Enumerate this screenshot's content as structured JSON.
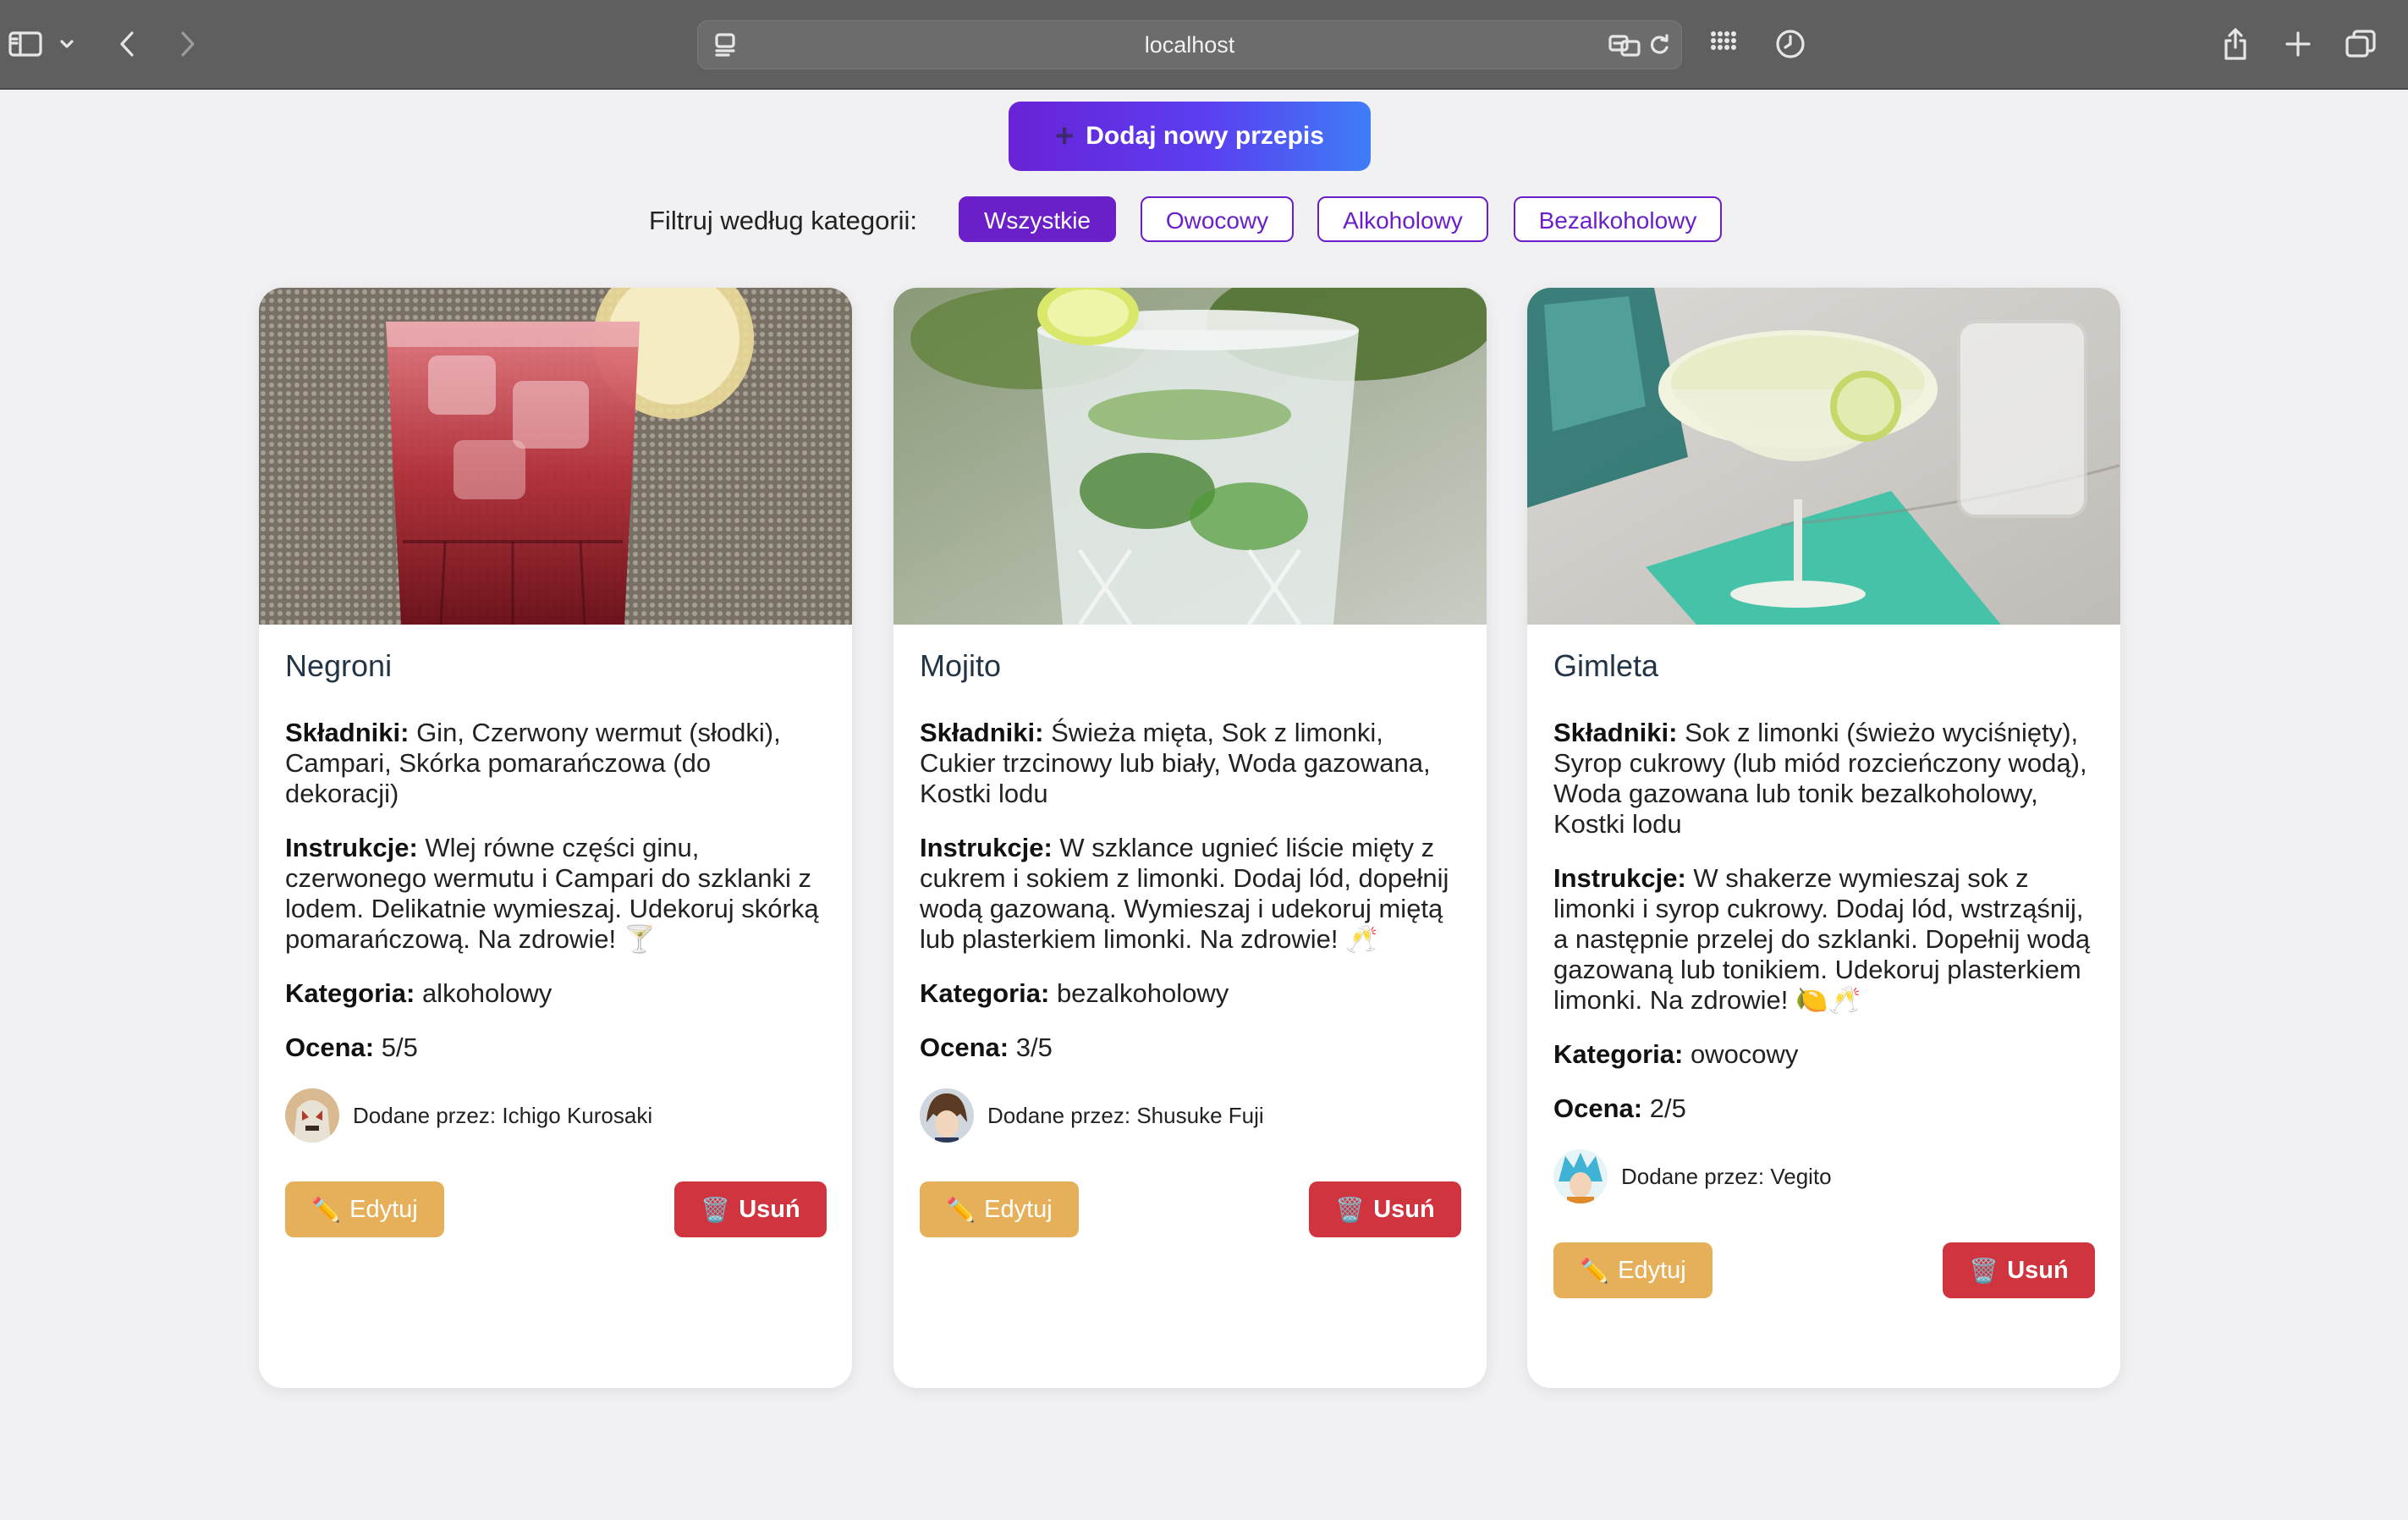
{
  "browser": {
    "url": "localhost"
  },
  "page": {
    "add_button_label": "Dodaj nowy przepis",
    "add_button_icon": "+",
    "filter_label": "Filtruj według kategorii:",
    "filters": [
      {
        "label": "Wszystkie",
        "active": true
      },
      {
        "label": "Owocowy",
        "active": false
      },
      {
        "label": "Alkoholowy",
        "active": false
      },
      {
        "label": "Bezalkoholowy",
        "active": false
      }
    ]
  },
  "labels": {
    "ingredients": "Składniki:",
    "instructions": "Instrukcje:",
    "category": "Kategoria:",
    "rating": "Ocena:",
    "added_by": "Dodane przez:",
    "edit": "Edytuj",
    "delete": "Usuń",
    "edit_icon": "✏️",
    "delete_icon": "🗑️"
  },
  "recipes": [
    {
      "name": "Negroni",
      "ingredients": "Gin, Czerwony wermut (słodki), Campari, Skórka pomarańczowa (do dekoracji)",
      "instructions": "Wlej równe części ginu, czerwonego wermutu i Campari do szklanki z lodem. Delikatnie wymieszaj. Udekoruj skórką pomarańczową. Na zdrowie! 🍸",
      "category": "alkoholowy",
      "rating": "5/5",
      "author": "Ichigo Kurosaki"
    },
    {
      "name": "Mojito",
      "ingredients": "Świeża mięta, Sok z limonki, Cukier trzcinowy lub biały, Woda gazowana, Kostki lodu",
      "instructions": "W szklance ugnieć liście mięty z cukrem i sokiem z limonki. Dodaj lód, dopełnij wodą gazowaną. Wymieszaj i udekoruj miętą lub plasterkiem limonki. Na zdrowie! 🥂",
      "category": "bezalkoholowy",
      "rating": "3/5",
      "author": "Shusuke Fuji"
    },
    {
      "name": "Gimleta",
      "ingredients": "Sok z limonki (świeżo wyciśnięty), Syrop cukrowy (lub miód rozcieńczony wodą), Woda gazowana lub tonik bezalkoholowy, Kostki lodu",
      "instructions": "W shakerze wymieszaj sok z limonki i syrop cukrowy. Dodaj lód, wstrząśnij, a następnie przelej do szklanki. Dopełnij wodą gazowaną lub tonikiem. Udekoruj plasterkiem limonki. Na zdrowie! 🍋🥂",
      "category": "owocowy",
      "rating": "2/5",
      "author": "Vegito"
    }
  ]
}
